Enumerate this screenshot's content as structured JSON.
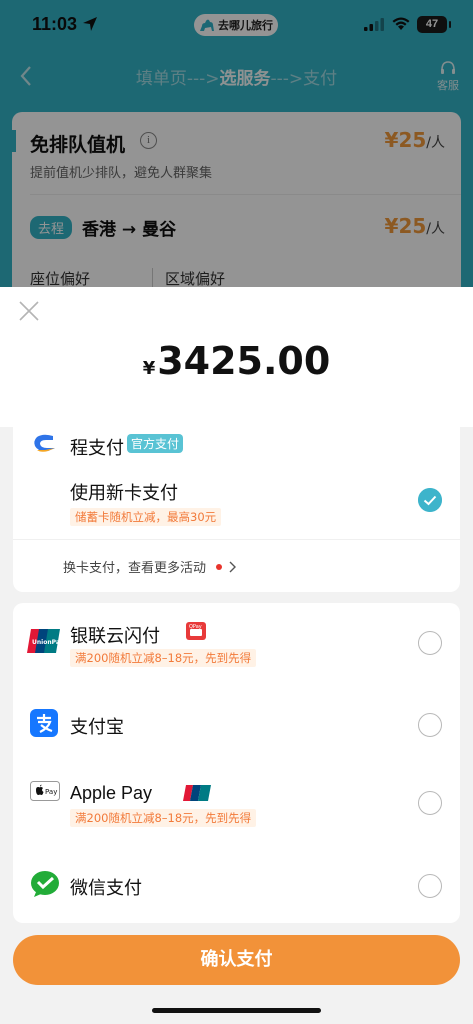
{
  "status": {
    "time": "11:03",
    "app": "去哪儿旅行",
    "battery": "47"
  },
  "nav": {
    "step1": "填单页",
    "arrow": "--->",
    "step2": "选服务",
    "step3": "支付",
    "service": "客服"
  },
  "service_card": {
    "title": "免排队值机",
    "price": "¥25",
    "unit": "/人",
    "subtitle": "提前值机少排队，避免人群聚集",
    "trip_badge": "去程",
    "route": "香港 → 曼谷",
    "trip_price": "¥25",
    "trip_unit": "/人",
    "pref_seat": "座位偏好",
    "pref_area": "区域偏好"
  },
  "sheet": {
    "currency": "¥",
    "amount": "3425.00"
  },
  "ctrip_pay": {
    "name": "程支付",
    "badge": "官方支付",
    "new_card": "使用新卡支付",
    "promo": "储蓄卡随机立减，最高30元",
    "switch_card": "换卡支付，查看更多活动"
  },
  "methods": {
    "unionpay": {
      "name": "银联云闪付",
      "promo": "满200随机立减8–18元，先到先得"
    },
    "alipay": {
      "name": "支付宝"
    },
    "applepay": {
      "name": "Apple Pay",
      "promo": "满200随机立减8–18元，先到先得"
    },
    "wechat": {
      "name": "微信支付"
    }
  },
  "confirm_label": "确认支付",
  "colors": {
    "teal": "#33b3c6",
    "orange": "#f29239",
    "price_orange": "#f29a3c",
    "promo_text": "#f27a3a"
  }
}
